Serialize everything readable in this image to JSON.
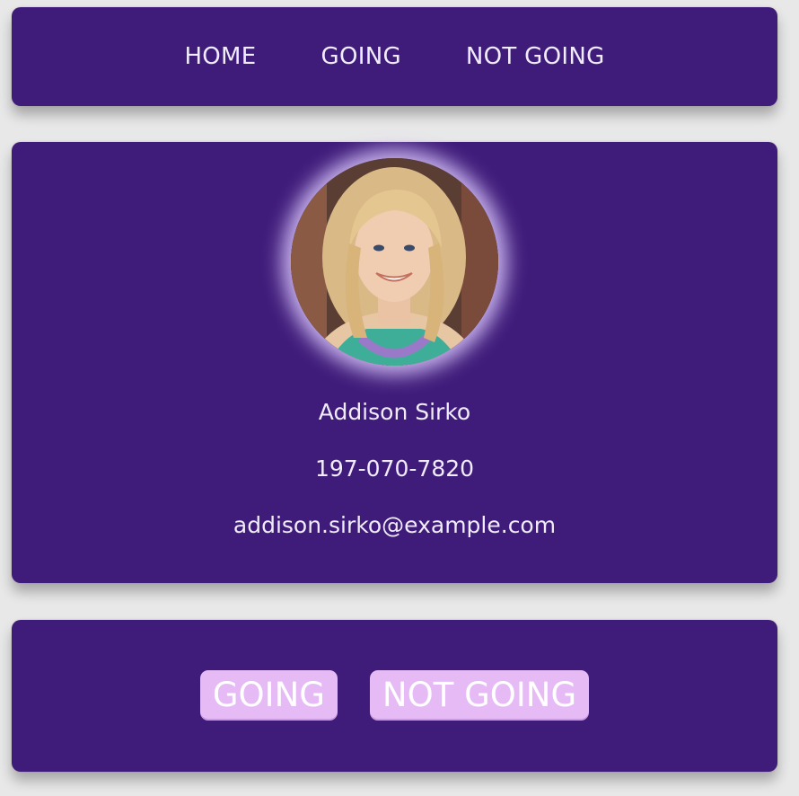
{
  "nav": {
    "items": [
      {
        "label": "HOME"
      },
      {
        "label": "GOING"
      },
      {
        "label": "NOT GOING"
      }
    ]
  },
  "profile": {
    "avatar_icon": "person-photo",
    "name": "Addison Sirko",
    "phone": "197-070-7820",
    "email": "addison.sirko@example.com"
  },
  "actions": {
    "going_label": "GOING",
    "not_going_label": "NOT GOING"
  },
  "colors": {
    "card_bg": "#3f1c7a",
    "page_bg": "#e8e8e8",
    "button_bg": "#e6bbf5",
    "text": "#f1ecfb"
  }
}
